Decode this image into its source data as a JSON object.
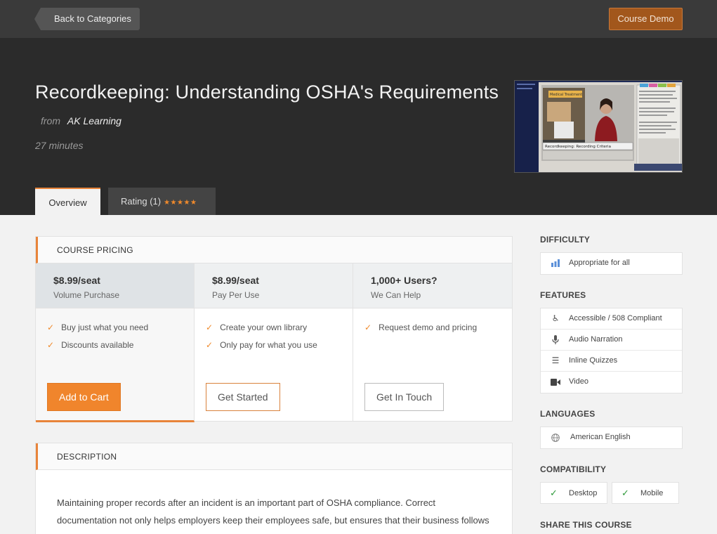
{
  "topbar": {
    "back_label": "Back to Categories",
    "demo_label": "Course Demo"
  },
  "course": {
    "title": "Recordkeeping: Understanding OSHA's Requirements",
    "from_label": "from",
    "provider": "AK Learning",
    "duration": "27 minutes",
    "thumbnail": {
      "panel_title": "Medical Treatment",
      "caption": "Recordkeeping: Recording Criteria"
    }
  },
  "tabs": [
    {
      "label": "Overview",
      "active": true
    },
    {
      "label": "Rating (1)",
      "stars": "★★★★★"
    }
  ],
  "pricing": {
    "heading": "COURSE PRICING",
    "plans": [
      {
        "price": "$8.99/seat",
        "subtitle": "Volume Purchase",
        "features": [
          "Buy just what you need",
          "Discounts available"
        ],
        "button": "Add to Cart"
      },
      {
        "price": "$8.99/seat",
        "subtitle": "Pay Per Use",
        "features": [
          "Create your own library",
          "Only pay for what you use"
        ],
        "button": "Get Started"
      },
      {
        "price": "1,000+ Users?",
        "subtitle": "We Can Help",
        "features": [
          "Request demo and pricing"
        ],
        "button": "Get In Touch"
      }
    ]
  },
  "description": {
    "heading": "DESCRIPTION",
    "text": "Maintaining proper records after an incident is an important part of OSHA compliance. Correct documentation not only helps employers keep their employees safe, but ensures that their business follows all necessary OSHA procedures."
  },
  "sidebar": {
    "difficulty": {
      "heading": "DIFFICULTY",
      "value": "Appropriate for all",
      "icon": "bar-chart-icon"
    },
    "features": {
      "heading": "FEATURES",
      "items": [
        {
          "label": "Accessible / 508 Compliant",
          "icon": "wheelchair-icon"
        },
        {
          "label": "Audio Narration",
          "icon": "microphone-icon"
        },
        {
          "label": "Inline Quizzes",
          "icon": "list-icon"
        },
        {
          "label": "Video",
          "icon": "video-camera-icon"
        }
      ]
    },
    "languages": {
      "heading": "LANGUAGES",
      "value": "American English",
      "icon": "globe-icon"
    },
    "compatibility": {
      "heading": "COMPATIBILITY",
      "items": [
        {
          "label": "Desktop",
          "icon": "check-icon"
        },
        {
          "label": "Mobile",
          "icon": "check-icon"
        }
      ]
    },
    "share": {
      "heading": "SHARE THIS COURSE"
    }
  },
  "colors": {
    "accent": "#f0852c",
    "topbar": "#3a3a3a",
    "hero": "#2b2b2b",
    "check_green": "#2e9a3a"
  }
}
